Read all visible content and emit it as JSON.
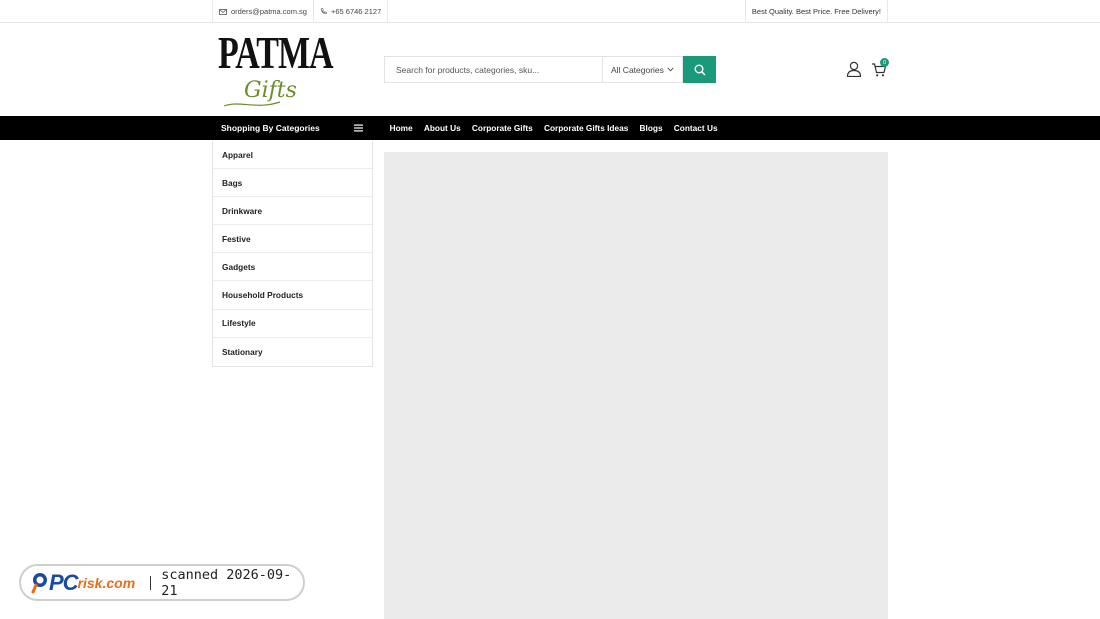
{
  "topbar": {
    "email": "orders@patma.com.sg",
    "phone": "+65 6746 2127",
    "tagline": "Best Quality. Best Price. Free Delivery!"
  },
  "logo": {
    "primary": "PATMA",
    "secondary": "Gifts"
  },
  "search": {
    "placeholder": "Search for products, categories, sku...",
    "category_selected": "All Categories"
  },
  "cart": {
    "count": "0"
  },
  "nav": {
    "categories_label": "Shopping By Categories",
    "links": [
      "Home",
      "About Us",
      "Corporate Gifts",
      "Corporate Gifts Ideas",
      "Blogs",
      "Contact Us"
    ]
  },
  "categories": [
    "Apparel",
    "Bags",
    "Drinkware",
    "Festive",
    "Gadgets",
    "Household Products",
    "Lifestyle",
    "Stationary"
  ],
  "watermark": {
    "brand_pc": "PC",
    "brand_risk": "risk.com",
    "scanned": "scanned 2026-09-21"
  },
  "colors": {
    "accent": "#1a9a7b",
    "nav_bg": "#000000",
    "banner_placeholder": "#ebebeb"
  }
}
